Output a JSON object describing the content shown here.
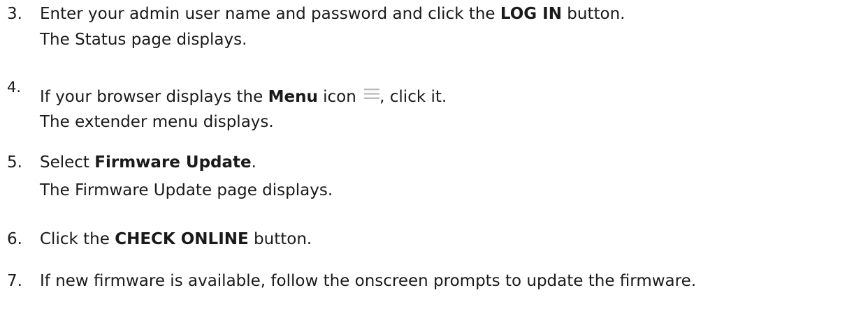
{
  "steps": [
    {
      "number": "3.",
      "line1_pre": "Enter your admin user name and password and click the ",
      "line1_bold": "LOG IN",
      "line1_post": " button.",
      "line2": "The Status page displays."
    },
    {
      "number": "4.",
      "line1_pre": "If your browser displays the ",
      "line1_bold": "Menu",
      "line1_mid": " icon ",
      "icon": "menu-hamburger-icon",
      "line1_post": ", click it.",
      "line2": "The extender menu displays."
    },
    {
      "number": "5.",
      "line1_pre": "Select ",
      "line1_bold": "Firmware Update",
      "line1_post": ".",
      "line2": "The Firmware Update page displays."
    },
    {
      "number": "6.",
      "line1_pre": "Click the ",
      "line1_bold": "CHECK ONLINE",
      "line1_post": " button."
    },
    {
      "number": "7.",
      "line1_pre": "If new firmware is available, follow the onscreen prompts to update the firmware."
    }
  ],
  "colors": {
    "text": "#1a1a1a",
    "icon": "#bdbdbd"
  }
}
